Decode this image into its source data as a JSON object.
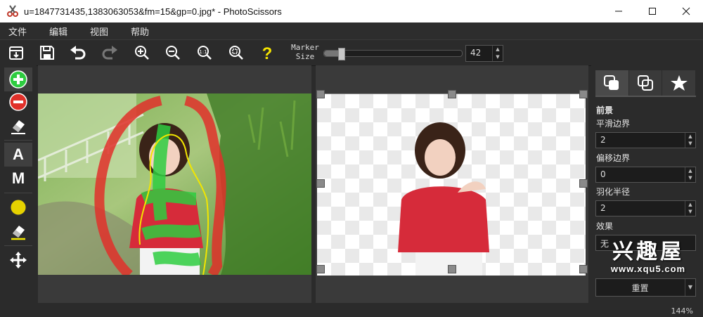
{
  "window": {
    "title": "u=1847731435,1383063053&fm=15&gp=0.jpg* - PhotoScissors",
    "app_icon": "scissors-app-icon",
    "controls": [
      "minimize-icon",
      "maximize-icon",
      "close-icon"
    ]
  },
  "menu": [
    "文件",
    "编辑",
    "视图",
    "帮助"
  ],
  "toolbar": {
    "buttons": [
      "open-icon",
      "save-icon",
      "undo-icon",
      "redo-icon",
      "zoom-in-icon",
      "zoom-out-icon",
      "actual-size-icon",
      "fit-window-icon",
      "help-icon"
    ],
    "marker_label_line1": "Marker",
    "marker_label_line2": "Size",
    "marker_size": "42",
    "marker_slider_fraction": 0.12
  },
  "left_tools": {
    "items": [
      "keep-marker-icon",
      "remove-marker-icon",
      "eraser-icon",
      "A",
      "M",
      "color-picker-icon",
      "color-eraser-icon",
      "move-icon"
    ]
  },
  "right_panel": {
    "tabs": [
      "foreground-tab-icon",
      "background-tab-icon",
      "effects-tab-icon"
    ],
    "section_title": "前景",
    "smooth_label": "平滑边界",
    "smooth_value": "2",
    "offset_label": "偏移边界",
    "offset_value": "0",
    "feather_label": "羽化半径",
    "feather_value": "2",
    "effect_label": "效果",
    "effect_value": "无",
    "reset_label": "重置"
  },
  "watermark": {
    "brand": "兴趣屋",
    "url": "www.xqu5.com"
  },
  "status": {
    "zoom": "144%"
  },
  "colors": {
    "accent_green": "#2ecc40",
    "accent_red": "#e0302a",
    "marker_yellow": "#f2e600"
  }
}
